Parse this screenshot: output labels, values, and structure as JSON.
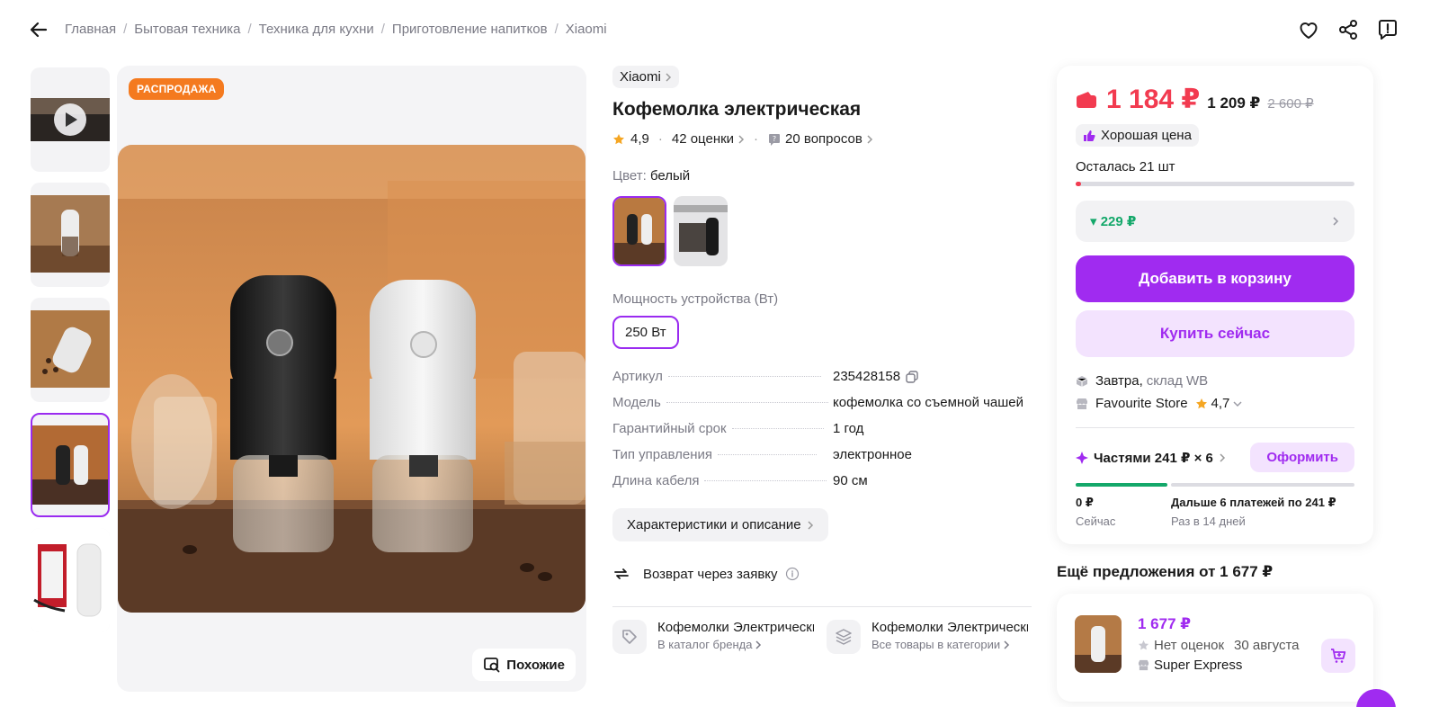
{
  "breadcrumb": [
    "Главная",
    "Бытовая техника",
    "Техника для кухни",
    "Приготовление напитков",
    "Xiaomi"
  ],
  "icons": {
    "back": "arrow-left-icon",
    "favorite": "heart-icon",
    "share": "share-icon",
    "report": "report-icon"
  },
  "gallery": {
    "sale_badge": "РАСПРОДАЖА",
    "similar_label": "Похожие",
    "thumbnails_count": 5,
    "active_thumbnail": 4
  },
  "product": {
    "brand": "Xiaomi",
    "title": "Кофемолка электрическая",
    "rating": "4,9",
    "reviews": "42 оценки",
    "questions": "20 вопросов",
    "color_label": "Цвет:",
    "color_value": "белый",
    "power_label": "Мощность устройства (Вт)",
    "power_value": "250 Вт",
    "specs": [
      {
        "key": "Артикул",
        "value": "235428158"
      },
      {
        "key": "Модель",
        "value": "кофемолка со съемной чашей"
      },
      {
        "key": "Гарантийный срок",
        "value": "1 год"
      },
      {
        "key": "Тип управления",
        "value": "электронное"
      },
      {
        "key": "Длина кабеля",
        "value": "90 см"
      }
    ],
    "specs_button": "Характеристики и описание",
    "return_text": "Возврат через заявку",
    "categories": [
      {
        "title": "Кофемолки Электрические",
        "sub": "В каталог бренда"
      },
      {
        "title": "Кофемолки Электрические",
        "sub": "Все товары в категории"
      }
    ]
  },
  "price_card": {
    "price_main": "1 184 ₽",
    "price_second": "1 209 ₽",
    "price_old": "2 600 ₽",
    "good_price": "Хорошая цена",
    "stock": "Осталась 21 шт",
    "stock_level": 0.02,
    "discount": "▾ 229 ₽",
    "add_to_cart": "Добавить в корзину",
    "buy_now": "Купить сейчас",
    "delivery_day": "Завтра,",
    "delivery_wh": "склад WB",
    "store_name": "Favourite Store",
    "store_rating": "4,7",
    "parts_label": "Частями 241 ₽ × 6",
    "order_button": "Оформить",
    "parts_now_amount": "0 ₽",
    "parts_now_label": "Сейчас",
    "parts_next_amount": "Дальше 6 платежей по 241 ₽",
    "parts_next_label": "Раз в 14 дней"
  },
  "offers": {
    "title": "Ещё предложения от 1 677 ₽",
    "items": [
      {
        "price": "1 677 ₽",
        "rating": "Нет оценок",
        "date": "30 августа",
        "seller": "Super Express"
      }
    ]
  },
  "colors": {
    "accent": "#a02bf0",
    "price_red": "#f23b50",
    "sale_orange": "#f47a1f",
    "discount_green": "#14a86a"
  }
}
